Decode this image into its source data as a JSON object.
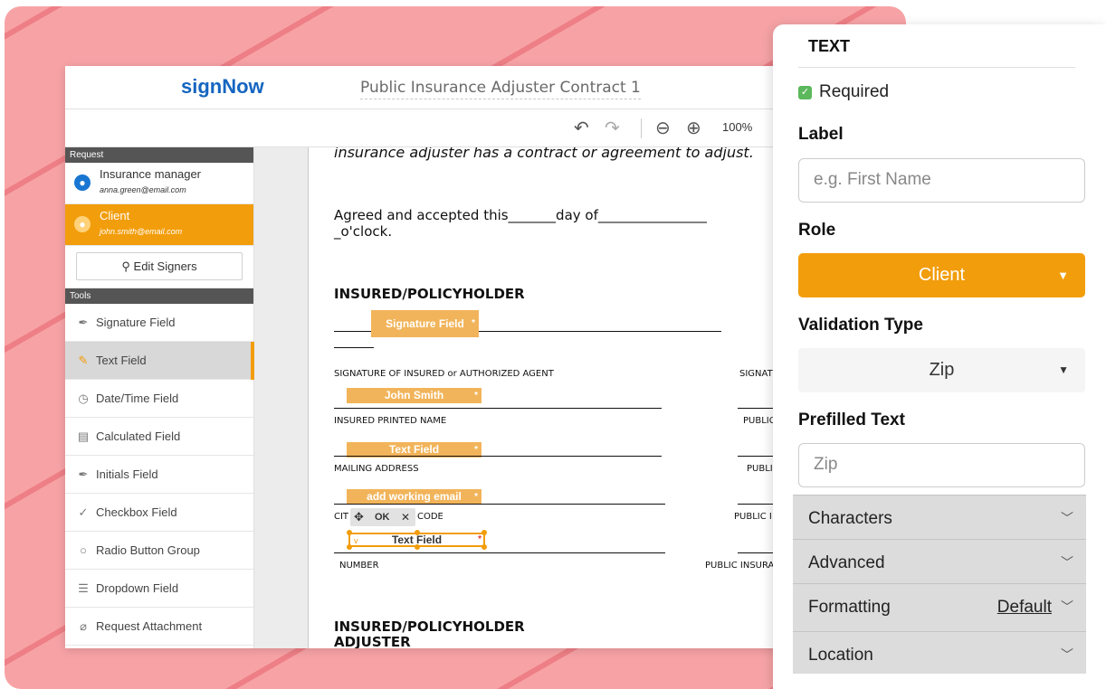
{
  "app": {
    "logo": "signNow",
    "doc_title": "Public Insurance Adjuster Contract 1"
  },
  "toolbar": {
    "undo_icon": "undo-icon",
    "redo_icon": "redo-icon",
    "zoom_out_icon": "zoom-out-icon",
    "zoom_in_icon": "zoom-in-icon",
    "zoom_level": "100%"
  },
  "sidebar": {
    "request_header": "Request",
    "signers": [
      {
        "name": "Insurance manager",
        "email": "anna.green@email.com",
        "active": false
      },
      {
        "name": "Client",
        "email": "john.smith@email.com",
        "active": true
      }
    ],
    "edit_signers_label": "Edit Signers",
    "tools_header": "Tools",
    "tools": [
      {
        "label": "Signature Field",
        "icon": "pen-nib-icon"
      },
      {
        "label": "Text Field",
        "icon": "pencil-icon",
        "active": true
      },
      {
        "label": "Date/Time Field",
        "icon": "clock-icon"
      },
      {
        "label": "Calculated Field",
        "icon": "calculator-icon"
      },
      {
        "label": "Initials Field",
        "icon": "pen-nib-icon"
      },
      {
        "label": "Checkbox Field",
        "icon": "checkmark-icon"
      },
      {
        "label": "Radio Button Group",
        "icon": "radio-icon"
      },
      {
        "label": "Dropdown Field",
        "icon": "dropdown-icon"
      },
      {
        "label": "Request Attachment",
        "icon": "paperclip-icon"
      }
    ]
  },
  "document": {
    "top_line": "insurance adjuster has a contract or agreement to adjust.",
    "agreed_line": "Agreed  and accepted this_______day  of________________",
    "oclock": "_o'clock.",
    "section1": "INSURED/POLICYHOLDER",
    "sig_caption": "SIGNATURE  OF INSURED or AUTHORIZED AGENT",
    "sig_right": "SIGNATUI",
    "printed_name_caption": "INSURED  PRINTED  NAME",
    "public_1": "PUBLIC",
    "mailing_caption": "MAILING  ADDRESS",
    "public_2": "PUBLI",
    "city_caption_prefix": "CIT",
    "city_caption_suffix": "CODE",
    "public_3": "PUBLIC I",
    "number_caption": "NUMBER",
    "public_ins": "PUBLIC INSURA",
    "section2_line1": "INSURED/POLICYHOLDER",
    "section2_line2": "ADJUSTER",
    "fields": {
      "signature": "Signature Field",
      "john_smith": "John Smith",
      "text_field": "Text Field",
      "email": "add working email",
      "selected": "Text Field",
      "star": "*"
    },
    "field_toolbar": {
      "move_icon": "move-icon",
      "ok": "OK",
      "close_icon": "close-icon"
    }
  },
  "panel": {
    "title": "TEXT",
    "required_label": "Required",
    "label_heading": "Label",
    "label_placeholder": "e.g. First Name",
    "role_heading": "Role",
    "role_value": "Client",
    "validation_heading": "Validation Type",
    "validation_value": "Zip",
    "prefilled_heading": "Prefilled Text",
    "prefilled_placeholder": "Zip",
    "sections": [
      {
        "label": "Characters"
      },
      {
        "label": "Advanced"
      },
      {
        "label": "Formatting",
        "value": "Default"
      },
      {
        "label": "Location"
      }
    ]
  },
  "colors": {
    "brand_blue": "#1565c0",
    "accent_orange": "#f29d0b",
    "field_orange": "#f2b45a",
    "check_green": "#5cb85c"
  }
}
